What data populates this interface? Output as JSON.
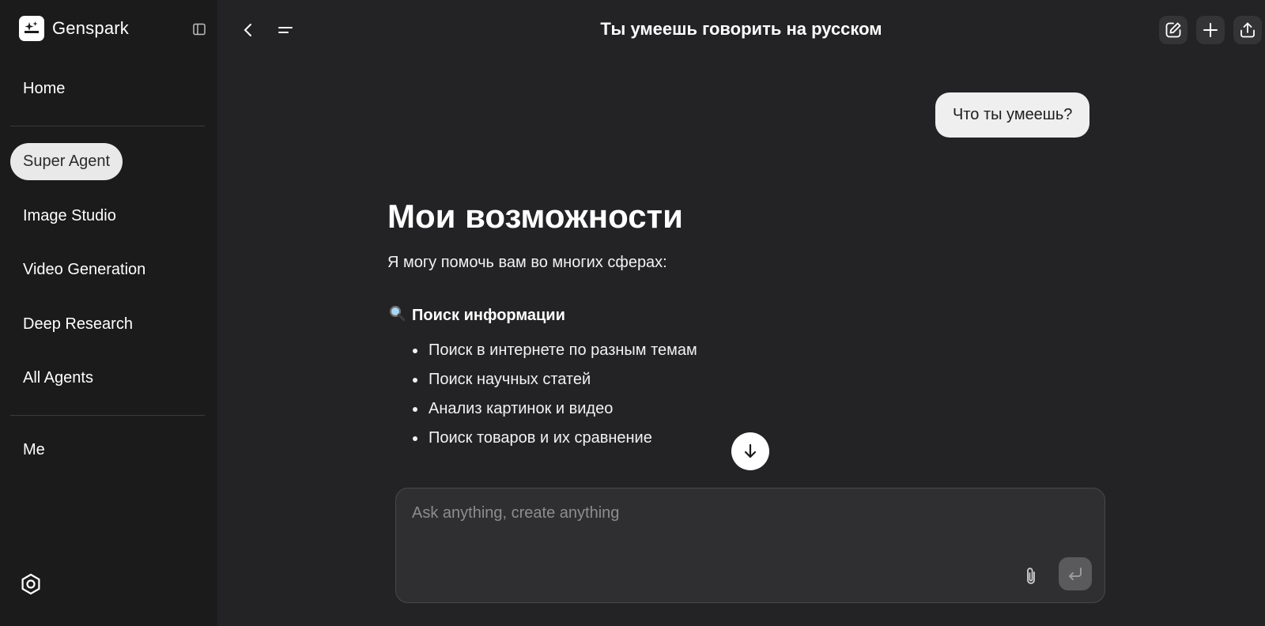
{
  "app": {
    "brand_name": "Genspark"
  },
  "sidebar": {
    "items": [
      {
        "label": "Home"
      },
      {
        "label": "Super Agent",
        "active": true
      },
      {
        "label": "Image Studio"
      },
      {
        "label": "Video Generation"
      },
      {
        "label": "Deep Research"
      },
      {
        "label": "All Agents"
      },
      {
        "label": "Me"
      }
    ]
  },
  "header": {
    "title": "Ты умеешь говорить на русском"
  },
  "chat": {
    "user_message": "Что ты умеешь?",
    "answer": {
      "title": "Мои возможности",
      "intro": "Я могу помочь вам во многих сферах:",
      "section_icon": "magnifier-icon",
      "section_title": "Поиск информации",
      "bullets": [
        "Поиск в интернете по разным темам",
        "Поиск научных статей",
        "Анализ картинок и видео",
        "Поиск товаров и их сравнение"
      ]
    }
  },
  "composer": {
    "placeholder": "Ask anything, create anything",
    "value": ""
  },
  "colors": {
    "sidebar_bg": "#1b1b1c",
    "main_bg": "#232325",
    "active_nav_bg": "#e9e9e9",
    "composer_bg": "#2f2f31"
  }
}
